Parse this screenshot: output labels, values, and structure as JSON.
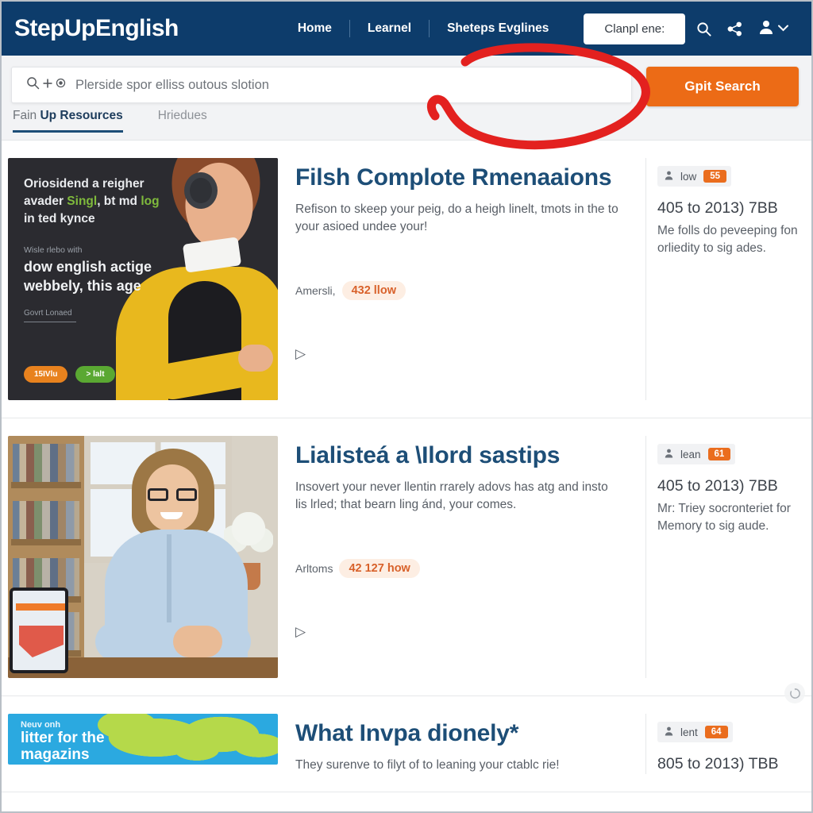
{
  "header": {
    "brand": "StepUpEnglish",
    "nav": [
      {
        "label": "Home"
      },
      {
        "label": "Learnel"
      },
      {
        "label": "Sheteps Evglines"
      }
    ],
    "cta_label": "Clanpl ene:",
    "icons": {
      "search": "search-icon",
      "share": "share-icon",
      "account": "account-icon",
      "chevron": "chevron-down-icon"
    },
    "colors": {
      "bar": "#0d3c6b",
      "accent": "#ec6b16"
    }
  },
  "search": {
    "placeholder": "Plerside spor elliss outous slotion",
    "button_label": "Gpit Search",
    "icons": [
      "search-icon",
      "plus-icon",
      "target-icon"
    ]
  },
  "tabs": [
    {
      "prefix": "Fain ",
      "label": "Up Resources",
      "active": true
    },
    {
      "prefix": "",
      "label": "Hriedues",
      "active": false
    }
  ],
  "results": [
    {
      "title": "Filsh Complote Rmenaaions",
      "desc": "Refison to skeep your peig, do a heigh linelt, tmots in the to your asioed undee your!",
      "meta_label": "Amersli,",
      "meta_chip": "432 llow",
      "play_icon": "play-icon",
      "aside": {
        "badge_icon": "person-icon",
        "badge_label": "low",
        "badge_num": "55",
        "heading": "405 to 2013) 7BB",
        "note": "Me folls do peveeping fon orliedity to sig ades."
      },
      "thumb": {
        "kind": "dark-headphones-banner",
        "headline_a": "Oriosidend a reigher avader ",
        "headline_green": "Singl",
        "headline_b": ", bt md",
        "headline_c": "log",
        "headline_d": " in ted kynce",
        "small": "Wisle rlebo with",
        "big": "dow english actige webbely, this age",
        "footer": "Govrt Lonaed",
        "pill_orange": "15IVlu",
        "pill_green": "> lalt"
      }
    },
    {
      "title": "Lialisteá a \\Ilord sastips",
      "desc": "Insovert your never llentin rrarely adovs has atg and insto lis lrled; that bearn ling ánd, your comes.",
      "meta_label": "Arltoms",
      "meta_chip": "42 127 how",
      "play_icon": "play-icon",
      "aside": {
        "badge_icon": "person-icon",
        "badge_label": "lean",
        "badge_num": "61",
        "heading": "405 to 2013) 7BB",
        "note": "Mr: Triey socronteriet for Memory to sig aude."
      },
      "thumb": {
        "kind": "library-desk-photo"
      }
    },
    {
      "title": "What Invpa dionely*",
      "desc": "They surenve to filyt of to leaning your ctablc rie!",
      "aside": {
        "badge_icon": "person-icon",
        "badge_label": "lent",
        "badge_num": "64",
        "heading": "805 to 2013) TBB"
      },
      "thumb": {
        "kind": "blue-world-map-banner",
        "small": "Neuv onh",
        "big_a": "litter for the",
        "big_b": "magazins"
      }
    }
  ],
  "annotation": {
    "kind": "red-circle-highlight",
    "color": "#e3211f"
  },
  "spinner_icon": "loading-icon"
}
